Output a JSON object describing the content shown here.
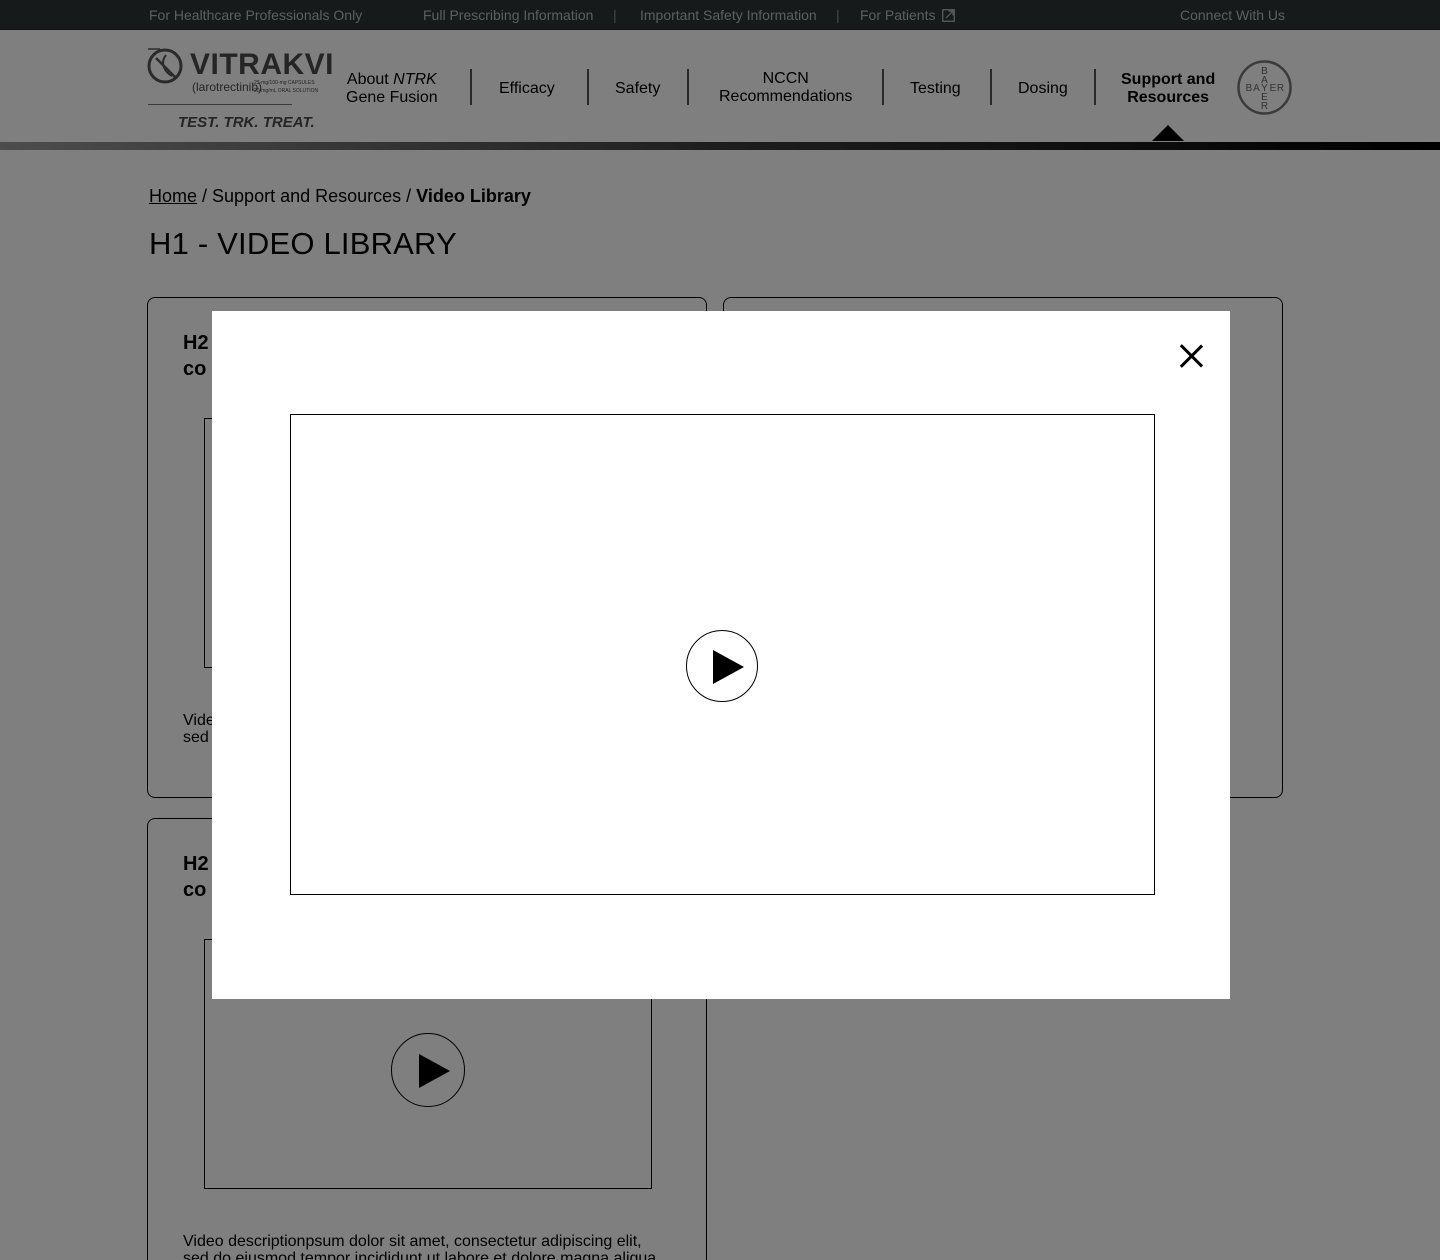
{
  "utility_bar": {
    "hcp_notice": "For Healthcare Professionals Only",
    "links": [
      "Full Prescribing Information",
      "Important Safety Information",
      "For Patients"
    ],
    "separator": "|",
    "connect": "Connect With Us"
  },
  "brand": {
    "name": "VITRAKVI",
    "generic": "(larotrectinib)",
    "dosage_line1": "25-mg/100-mg CAPSULES",
    "dosage_line2": "20-mg/mL ORAL SOLUTION",
    "tagline": "TEST. TRK. TREAT."
  },
  "nav": {
    "items": [
      {
        "line1_prefix": "About ",
        "line1_em": "NTRK",
        "line2": "Gene Fusion"
      },
      {
        "label": "Efficacy"
      },
      {
        "label": "Safety"
      },
      {
        "line1": "NCCN",
        "line2": "Recommendations"
      },
      {
        "label": "Testing"
      },
      {
        "label": "Dosing"
      },
      {
        "line1": "Support and",
        "line2": "Resources",
        "active": true
      }
    ],
    "bayer_letters": [
      "B",
      "A",
      "Y",
      "E",
      "R"
    ]
  },
  "breadcrumb": {
    "home": "Home",
    "sep": " / ",
    "middle": "Support and Resources",
    "current": "Video Library"
  },
  "page": {
    "title": "H1 - VIDEO LIBRARY"
  },
  "cards": [
    {
      "title_line1": "H2",
      "title_line2": "co",
      "desc_line1": "Vide",
      "desc_line2": "sed"
    },
    {
      "title_line1": "H2",
      "title_line2": "co",
      "desc_line1": "Video descriptionpsum dolor sit amet, consectetur adipiscing elit,",
      "desc_line2": "sed do eiusmod tempor incididunt ut labore et dolore magna aliqua"
    }
  ],
  "colors": {
    "utility_bg": "#2f3437",
    "overlay": "rgba(0,0,0,0.5)"
  },
  "icons": {
    "external_link": "external-link-icon",
    "play": "play-icon",
    "close": "close-icon"
  }
}
